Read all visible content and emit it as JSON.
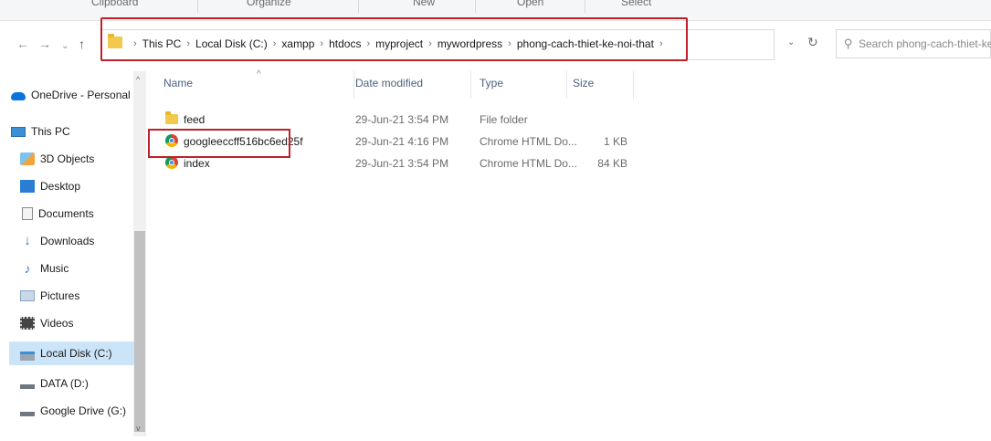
{
  "ribbon": {
    "groups": [
      "Clipboard",
      "Organize",
      "New",
      "Open",
      "Select"
    ]
  },
  "nav_buttons": {
    "back": "←",
    "forward": "→",
    "recent": "⌄",
    "up": "↑"
  },
  "address": {
    "crumbs": [
      "This PC",
      "Local Disk (C:)",
      "xampp",
      "htdocs",
      "myproject",
      "mywordpress",
      "phong-cach-thiet-ke-noi-that"
    ],
    "separator": "›",
    "dropdown": "⌄",
    "refresh": "↻"
  },
  "search": {
    "placeholder": "Search phong-cach-thiet-ke..."
  },
  "nav_pane": {
    "items": [
      {
        "label": "OneDrive - Personal",
        "icon": "onedrive-icon"
      },
      {
        "label": "This PC",
        "icon": "this-pc-icon"
      },
      {
        "label": "3D Objects",
        "icon": "3d-objects-icon"
      },
      {
        "label": "Desktop",
        "icon": "desktop-icon"
      },
      {
        "label": "Documents",
        "icon": "documents-icon"
      },
      {
        "label": "Downloads",
        "icon": "downloads-icon"
      },
      {
        "label": "Music",
        "icon": "music-icon"
      },
      {
        "label": "Pictures",
        "icon": "pictures-icon"
      },
      {
        "label": "Videos",
        "icon": "videos-icon"
      },
      {
        "label": "Local Disk (C:)",
        "icon": "local-disk-icon",
        "selected": true
      },
      {
        "label": "DATA (D:)",
        "icon": "drive-icon"
      },
      {
        "label": "Google Drive (G:)",
        "icon": "drive-icon"
      }
    ]
  },
  "file_list": {
    "columns": [
      "Name",
      "Date modified",
      "Type",
      "Size"
    ],
    "rows": [
      {
        "name": "feed",
        "date": "29-Jun-21 3:54 PM",
        "type": "File folder",
        "size": "",
        "icon": "folder-icon"
      },
      {
        "name": "googleeccff516bc6ed25f",
        "date": "29-Jun-21 4:16 PM",
        "type": "Chrome HTML Do...",
        "size": "1 KB",
        "icon": "chrome-icon"
      },
      {
        "name": "index",
        "date": "29-Jun-21 3:54 PM",
        "type": "Chrome HTML Do...",
        "size": "84 KB",
        "icon": "chrome-icon"
      }
    ]
  },
  "colors": {
    "highlight": "#c0202a",
    "selection": "#cce4f7",
    "folder": "#f2c94c"
  }
}
